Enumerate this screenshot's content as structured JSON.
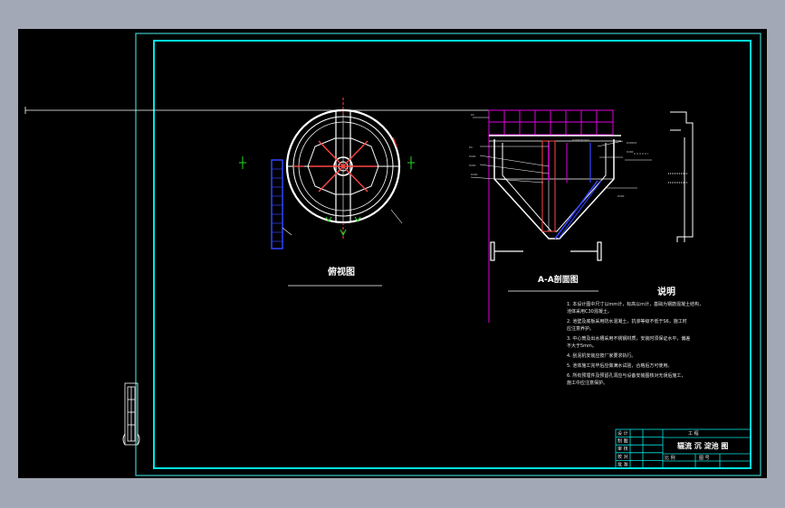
{
  "colors": {
    "background": "#000000",
    "frame_outer": "#3fc9c9",
    "frame_inner": "#00e6e6",
    "magenta": "#e000e0",
    "white": "#ffffff",
    "blue": "#2e3bff",
    "green": "#22dd22",
    "red": "#ff3333",
    "workspace_border": "#a3a8b6"
  },
  "views": {
    "plan_title": "俯视图",
    "section_title": "A-A剖面图"
  },
  "notes": {
    "heading": "说明",
    "lines": [
      "1. 本设计图中尺寸以mm计，标高以m计，基础为钢筋混凝土结构，",
      "   池体采用C30混凝土。",
      "2. 池壁及底板采用防水混凝土，抗渗等级不低于S6，施工时",
      "   应注意养护。",
      "3. 中心筒及出水槽采用不锈钢材质，安装时须保证水平，偏差",
      "   不大于5mm。",
      "4. 刮泥机安装应按厂家要求执行。",
      "5. 池体施工完毕后应做满水试验，合格后方可使用。",
      "6. 所有预埋件及预留孔洞应与设备安装图核对无误后施工，",
      "   施工中应注意保护。"
    ]
  },
  "title_block": {
    "top_label": "工 程",
    "drawing_title": "辐流 沉 淀池 图",
    "row_labels": [
      "设 计",
      "制 图",
      "审 核",
      "校 对",
      "批 准"
    ],
    "bottom_left": "比 例",
    "bottom_right": "图 号"
  }
}
